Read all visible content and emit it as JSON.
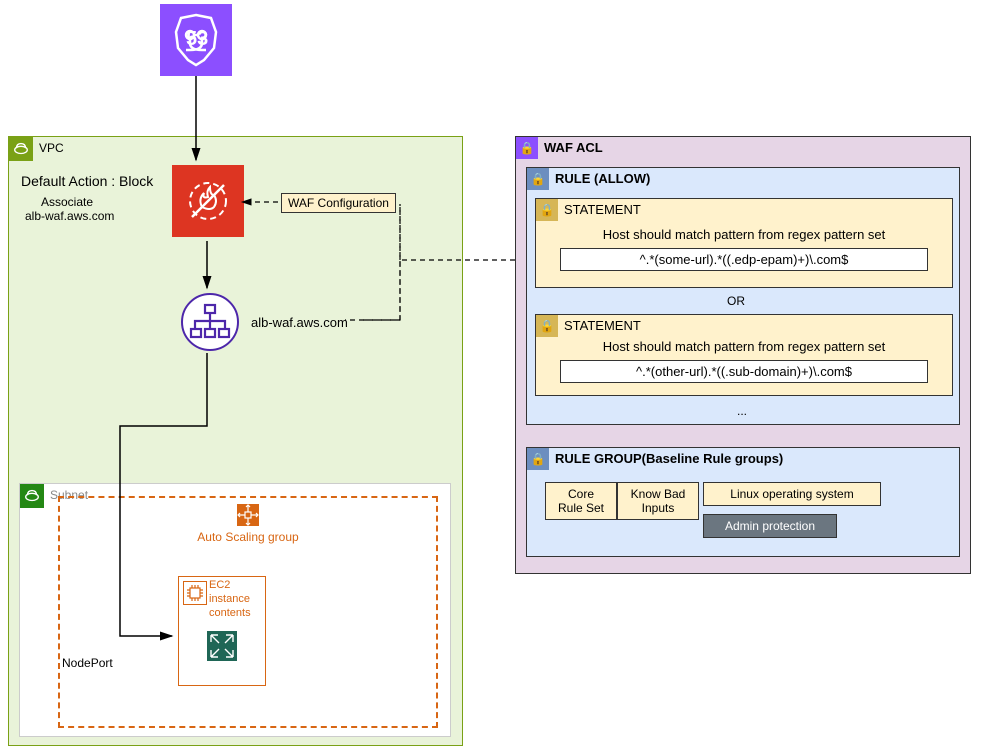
{
  "route53_label": "53",
  "vpc": {
    "title": "VPC",
    "default_action": "Default Action : Block",
    "associate_label": "Associate",
    "associate_value": "alb-waf.aws.com",
    "alb_label": "alb-waf.aws.com",
    "waf_config_label": "WAF Configuration",
    "nodeport_label": "NodePort"
  },
  "subnet": {
    "title": "Subnet",
    "asg_title": "Auto Scaling group",
    "ec2_title": "EC2\ninstance\ncontents"
  },
  "waf_acl": {
    "title": "WAF ACL",
    "rule_allow": {
      "title": "RULE (ALLOW)",
      "or_label": "OR",
      "ellipsis": "...",
      "statements": [
        {
          "title": "STATEMENT",
          "desc": "Host should match pattern from regex pattern set",
          "regex": "^.*(some-url).*((.edp-epam)+)\\.com$"
        },
        {
          "title": "STATEMENT",
          "desc": "Host should match pattern from regex pattern set",
          "regex": "^.*(other-url).*((.sub-domain)+)\\.com$"
        }
      ]
    },
    "rule_group": {
      "title": "RULE GROUP(Baseline Rule groups)",
      "items": [
        "Core\nRule Set",
        "Know Bad\nInputs",
        "Linux operating system",
        "Admin protection"
      ]
    }
  }
}
